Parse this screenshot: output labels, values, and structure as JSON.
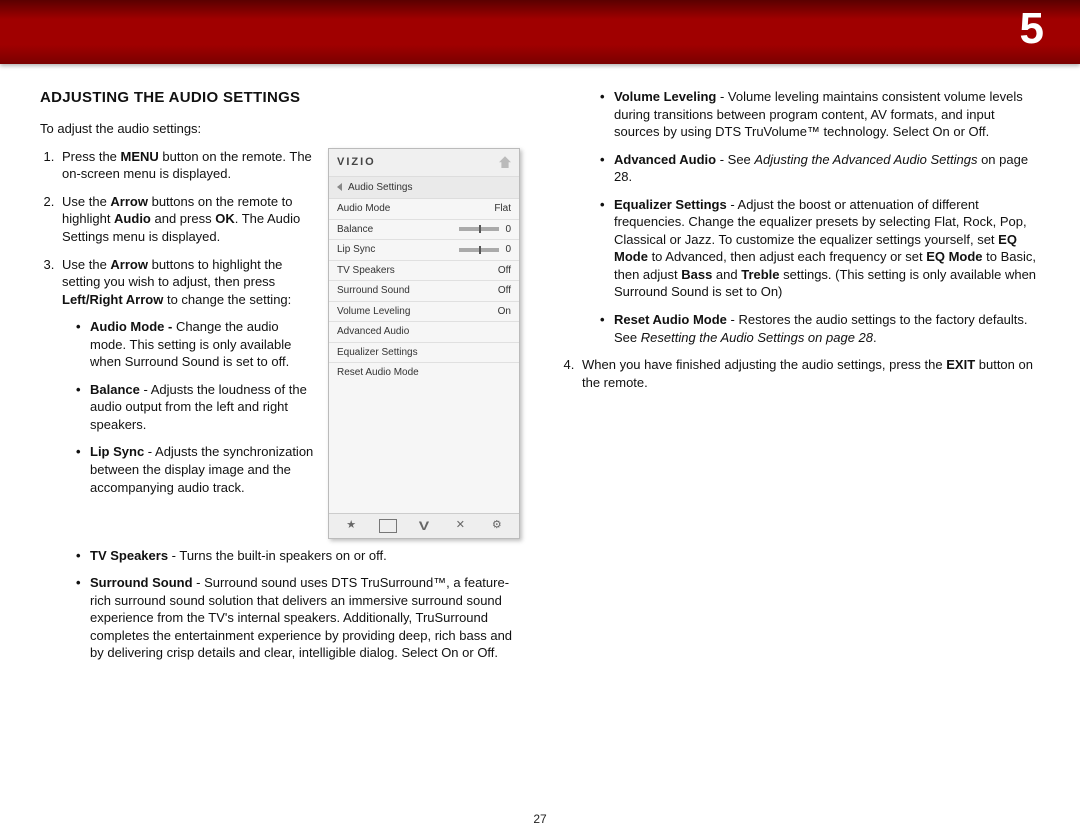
{
  "chapter_number": "5",
  "page_number": "27",
  "heading": "ADJUSTING THE AUDIO SETTINGS",
  "intro": "To adjust the audio settings:",
  "steps": {
    "s1a": "Press the ",
    "s1b": "MENU",
    "s1c": " button on the remote. The on-screen menu is displayed.",
    "s2a": "Use the ",
    "s2b": "Arrow",
    "s2c": " buttons on the remote to highlight ",
    "s2d": "Audio",
    "s2e": " and press ",
    "s2f": "OK",
    "s2g": ". The Audio Settings menu is displayed.",
    "s3a": "Use the ",
    "s3b": "Arrow",
    "s3c": " buttons to highlight the setting you wish to adjust, then press ",
    "s3d": "Left/Right Arrow",
    "s3e": " to change the setting:"
  },
  "bullets_left": {
    "audio_mode_t": "Audio Mode - ",
    "audio_mode": "Change the audio mode. This setting is only available when Surround Sound is set to off.",
    "balance_t": "Balance",
    "balance": " - Adjusts the loudness of the audio output from the left and right speakers.",
    "lipsync_t": "Lip Sync",
    "lipsync": " - Adjusts the synchronization between the display image and the accompanying audio track.",
    "tvspk_t": "TV Speakers",
    "tvspk": " - Turns the built-in speakers on or off.",
    "surround_t": "Surround Sound",
    "surround": " - Surround sound uses DTS TruSurround™, a feature-rich surround sound solution that delivers an immersive surround sound experience from the TV's internal speakers. Additionally, TruSurround completes the entertainment experience by providing deep, rich bass and by delivering crisp details and clear, intelligible dialog. Select On or Off."
  },
  "bullets_right": {
    "vollev_t": "Volume Leveling",
    "vollev": " - Volume leveling maintains consistent volume levels during transitions between program content, AV formats, and input sources by using DTS TruVolume™ technology. Select On or Off.",
    "advaudio_t": "Advanced Audio",
    "advaudio_a": " - See ",
    "advaudio_i": "Adjusting the Advanced Audio Settings",
    "advaudio_b": " on page 28.",
    "eq_t": "Equalizer Settings",
    "eq_a": " - Adjust the boost or attenuation of different frequencies. Change the equalizer presets by selecting Flat, Rock, Pop, Classical or Jazz. To customize the equalizer settings yourself, set ",
    "eq_b": "EQ Mode",
    "eq_c": " to Advanced, then adjust each frequency or set ",
    "eq_d": "EQ Mode",
    "eq_e": " to Basic, then adjust ",
    "eq_f": "Bass",
    "eq_g": " and ",
    "eq_h": "Treble",
    "eq_i": " settings. (This setting is only available when Surround Sound is set to On)",
    "reset_t": "Reset Audio Mode",
    "reset_a": " - Restores the audio settings to the factory defaults. See ",
    "reset_i": "Resetting the Audio Settings on page 28",
    "reset_b": "."
  },
  "step4a": "When you have finished adjusting the audio settings, press the ",
  "step4b": "EXIT",
  "step4c": " button on the remote.",
  "osd": {
    "logo": "VIZIO",
    "title": "Audio Settings",
    "rows": [
      {
        "label": "Audio Mode",
        "value": "Flat",
        "kind": "text"
      },
      {
        "label": "Balance",
        "value": "0",
        "kind": "slider"
      },
      {
        "label": "Lip Sync",
        "value": "0",
        "kind": "slider"
      },
      {
        "label": "TV Speakers",
        "value": "Off",
        "kind": "text"
      },
      {
        "label": "Surround Sound",
        "value": "Off",
        "kind": "text"
      },
      {
        "label": "Volume Leveling",
        "value": "On",
        "kind": "text"
      },
      {
        "label": "Advanced Audio",
        "value": "",
        "kind": "text"
      },
      {
        "label": "Equalizer Settings",
        "value": "",
        "kind": "text"
      },
      {
        "label": "Reset Audio Mode",
        "value": "",
        "kind": "text"
      }
    ]
  }
}
